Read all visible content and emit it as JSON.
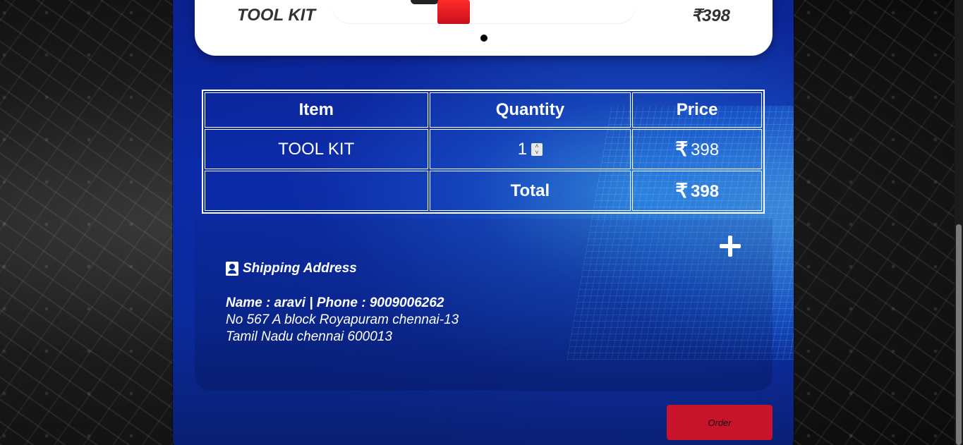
{
  "product_carousel": {
    "name": "TOOL KIT",
    "price": "₹398"
  },
  "cart_table": {
    "headers": {
      "item": "Item",
      "quantity": "Quantity",
      "price": "Price"
    },
    "row": {
      "item": "TOOL KIT",
      "quantity": "1",
      "currency_symbol": "₹",
      "price": "398"
    },
    "total": {
      "label": "Total",
      "currency_symbol": "₹",
      "value": "398"
    }
  },
  "shipping": {
    "heading": "Shipping Address",
    "name_phone": "Name : aravi | Phone : 9009006262",
    "address_line1": "No 567 A block Royapuram chennai-13",
    "address_line2": "Tamil Nadu chennai 600013"
  },
  "actions": {
    "order_label": "Order"
  },
  "colors": {
    "panel_blue": "#0b2aa8",
    "order_button": "#c8142a",
    "card_white": "#ffffff"
  },
  "icons": {
    "add": "plus-icon",
    "address": "address-card-icon"
  }
}
